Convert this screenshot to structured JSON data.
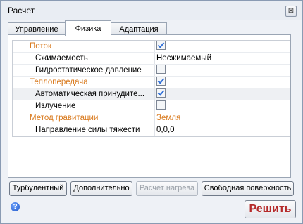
{
  "window": {
    "title": "Расчет",
    "close_glyph": "⊠"
  },
  "tabs": [
    {
      "label": "Управление",
      "active": false
    },
    {
      "label": "Физика",
      "active": true
    },
    {
      "label": "Адаптация",
      "active": false
    }
  ],
  "properties": [
    {
      "type": "category",
      "name": "Поток",
      "value": "",
      "checkbox": "checked"
    },
    {
      "type": "item",
      "name": "Сжимаемость",
      "value": "Несжимаемый"
    },
    {
      "type": "item",
      "name": "Гидростатическое давление",
      "value": "",
      "checkbox": "unchecked"
    },
    {
      "type": "category",
      "name": "Теплопередача",
      "value": "",
      "checkbox": "checked"
    },
    {
      "type": "item",
      "name": "Автоматическая принудите...",
      "value": "",
      "checkbox": "checked",
      "selected": true
    },
    {
      "type": "item",
      "name": "Излучение",
      "value": "",
      "checkbox": "unchecked"
    },
    {
      "type": "category",
      "name": "Метод гравитации",
      "value": "Земля"
    },
    {
      "type": "item",
      "name": "Направление силы тяжести",
      "value": "0,0,0"
    }
  ],
  "buttons": {
    "turbulent": "Турбулентный",
    "advanced": "Дополнительно",
    "heat_calc": "Расчет нагрева",
    "free_surface": "Свободная поверхность"
  },
  "footer": {
    "help_glyph": "?",
    "solve_label": "Решить"
  },
  "colors": {
    "category_text": "#d97a1e",
    "solve_text": "#b52a2a",
    "check_mark": "#2f6fd8"
  },
  "icons": [
    "close-icon",
    "help-icon",
    "checkbox-checked",
    "checkbox-unchecked"
  ]
}
